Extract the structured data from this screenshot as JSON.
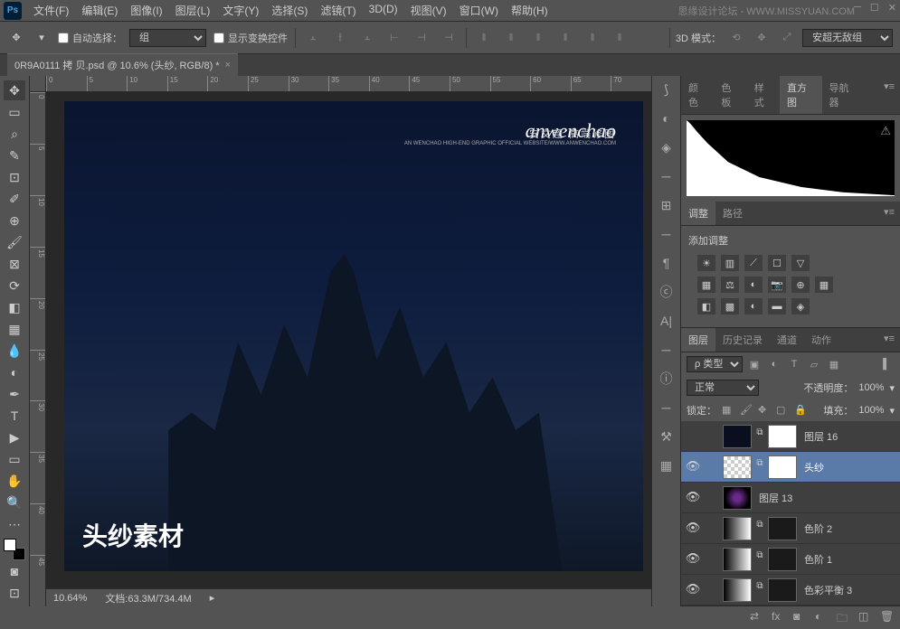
{
  "menubar": {
    "items": [
      "文件(F)",
      "编辑(E)",
      "图像(I)",
      "图层(L)",
      "文字(Y)",
      "选择(S)",
      "滤镜(T)",
      "3D(D)",
      "视图(V)",
      "窗口(W)",
      "帮助(H)"
    ]
  },
  "watermark": "思缘设计论坛 - WWW.MISSYUAN.COM",
  "options": {
    "auto_select": "自动选择：",
    "group": "组",
    "show_transform": "显示变换控件",
    "mode_3d": "3D 模式：",
    "preset": "安超无敌组"
  },
  "tab": {
    "title": "0R9A0111 拷 贝.psd @ 10.6% (头纱, RGB/8) *"
  },
  "ruler_h": [
    "0",
    "5",
    "10",
    "15",
    "20",
    "25",
    "30",
    "35",
    "40",
    "45",
    "50",
    "55",
    "60",
    "65",
    "70"
  ],
  "ruler_v": [
    "0",
    "5",
    "10",
    "15",
    "20",
    "25",
    "30",
    "35",
    "40",
    "45"
  ],
  "canvas": {
    "watermark_main": "anwenchao",
    "watermark_sub": "安文超 高端修图",
    "watermark_tiny": "AN WENCHAO HIGH-END GRAPHIC OFFICIAL WEBSITE/WWW.ANWENCHAO.COM",
    "caption": "头纱素材"
  },
  "status": {
    "zoom": "10.64%",
    "doc": "文档:63.3M/734.4M"
  },
  "panel_tabs_top": [
    "颜色",
    "色板",
    "样式",
    "直方图",
    "导航器"
  ],
  "panel_tabs_adj": [
    "调整",
    "路径"
  ],
  "adjustments_title": "添加调整",
  "panel_tabs_layers": [
    "图层",
    "历史记录",
    "通道",
    "动作"
  ],
  "layer_filter_label": "ρ 类型",
  "blend": {
    "mode": "正常",
    "opacity_label": "不透明度：",
    "opacity": "100%",
    "lock_label": "锁定：",
    "fill_label": "填充：",
    "fill": "100%"
  },
  "layers": [
    {
      "name": "图层 16",
      "eye": false,
      "thumb": "dark",
      "mask": true,
      "selected": false,
      "link": true
    },
    {
      "name": "头纱",
      "eye": true,
      "thumb": "checker",
      "mask": true,
      "selected": true,
      "link": true
    },
    {
      "name": "图层 13",
      "eye": true,
      "thumb": "purple",
      "mask": false,
      "selected": false,
      "link": false
    },
    {
      "name": "色阶 2",
      "eye": true,
      "thumb": "grad",
      "mask": true,
      "mask_dark": true,
      "selected": false,
      "link": true
    },
    {
      "name": "色阶 1",
      "eye": true,
      "thumb": "grad",
      "mask": true,
      "mask_dark": true,
      "selected": false,
      "link": true
    },
    {
      "name": "色彩平衡 3",
      "eye": true,
      "thumb": "grad",
      "mask": true,
      "mask_dark": true,
      "selected": false,
      "link": true
    }
  ]
}
